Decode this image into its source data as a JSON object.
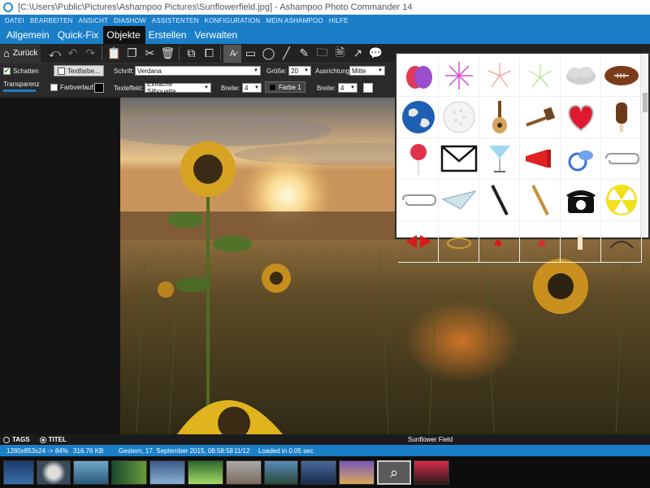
{
  "window": {
    "title": "[C:\\Users\\Public\\Pictures\\Ashampoo Pictures\\Sunflowerfield.jpg] - Ashampoo Photo Commander 14"
  },
  "menu": [
    "DATEI",
    "BEARBEITEN",
    "ANSICHT",
    "DIASHOW",
    "ASSISTENTEN",
    "KONFIGURATION",
    "MEIN ASHAMPOO",
    "HILFE"
  ],
  "tabs": [
    "Allgemein",
    "Quick-Fix",
    "Objekte",
    "Erstellen",
    "Verwalten"
  ],
  "active_tab": "Objekte",
  "toolbar": {
    "back_label": "Zurück",
    "icons": [
      "undo-all-icon",
      "undo-icon",
      "redo-icon",
      "paste-icon",
      "copy-icon",
      "cut-icon",
      "delete-icon",
      "bring-front-icon",
      "send-back-icon",
      "text-icon",
      "rectangle-icon",
      "ellipse-icon",
      "line-icon",
      "pen-icon",
      "clipart-icon",
      "note-icon",
      "arrow-icon",
      "callout-icon"
    ]
  },
  "options": {
    "shadow_label": "Schatten",
    "shadow_checked": true,
    "text_color_label": "Textfarbe...",
    "gradient_label": "Farbverlauf:",
    "transparency_label": "Transparenz",
    "font_label": "Schrift:",
    "font_value": "Verdana",
    "texteffect_label": "Texteffekt:",
    "texteffect_value": "Einfache Silhouette",
    "size_label": "Größe:",
    "size_value": "20",
    "width_label": "Breite:",
    "width_value": "4",
    "align_label": "Ausrichtung:",
    "align_value": "Mitte",
    "color1_label": "Farbe 1",
    "width2_label": "Breite:",
    "width2_value": "4"
  },
  "clipart": [
    "easter-eggs-icon",
    "fireworks-icon",
    "fireworks-icon",
    "fireworks-icon",
    "cloud-icon",
    "football-icon",
    "globe-icon",
    "golf-ball-icon",
    "guitar-icon",
    "gavel-icon",
    "heart-icon",
    "ice-cream-icon",
    "lollipop-icon",
    "envelope-icon",
    "cocktail-icon",
    "megaphone-icon",
    "pacifier-icon",
    "paperclip-icon",
    "paperclip-icon",
    "paper-plane-icon",
    "pen-icon",
    "pencil-icon",
    "telephone-icon",
    "radiation-icon",
    "bow-icon",
    "ring-icon",
    "petals-icon",
    "petals-icon",
    "candle-icon",
    "headphones-icon"
  ],
  "tagbar": {
    "tags_label": "TAGS",
    "title_label": "TITEL",
    "image_title": "Sunflower Field"
  },
  "status": {
    "dimensions": "1280x853x24 -> 84%",
    "filesize": "316.76 KB",
    "date": "Gestern, 17. September 2015, 08:58:58",
    "position": "11/12",
    "loadtime": "Loaded in 0.05 sec"
  },
  "colors": {
    "accent": "#1b7fc8",
    "dark": "#1b1b1b"
  }
}
